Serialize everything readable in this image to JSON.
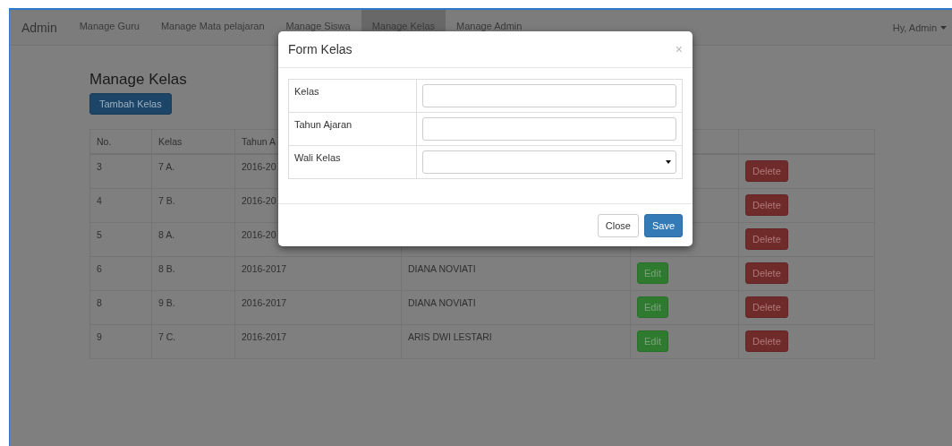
{
  "navbar": {
    "brand": "Admin",
    "items": [
      {
        "label": "Manage Guru",
        "selected": false
      },
      {
        "label": "Manage Mata pelajaran",
        "selected": false
      },
      {
        "label": "Manage Siswa",
        "selected": false
      },
      {
        "label": "Manage Kelas",
        "selected": true
      },
      {
        "label": "Manage Admin",
        "selected": false
      }
    ],
    "user_menu": "Hy, Admin"
  },
  "page": {
    "title": "Manage Kelas",
    "add_button": "Tambah Kelas"
  },
  "table": {
    "columns": [
      "No.",
      "Kelas",
      "Tahun A"
    ],
    "rows": [
      {
        "no": "3",
        "kelas": "7 A.",
        "tahun": "2016-20",
        "delete": "Delete"
      },
      {
        "no": "4",
        "kelas": "7 B.",
        "tahun": "2016-20",
        "delete": "Delete"
      },
      {
        "no": "5",
        "kelas": "8 A.",
        "tahun": "2016-20",
        "delete": "Delete"
      },
      {
        "no": "6",
        "kelas": "8 B.",
        "tahun": "2016-2017",
        "wali": "DIANA NOVIATI",
        "edit": "Edit",
        "delete": "Delete"
      },
      {
        "no": "8",
        "kelas": "9 B.",
        "tahun": "2016-2017",
        "wali": "DIANA NOVIATI",
        "edit": "Edit",
        "delete": "Delete"
      },
      {
        "no": "9",
        "kelas": "7 C.",
        "tahun": "2016-2017",
        "wali": "ARIS DWI LESTARI",
        "edit": "Edit",
        "delete": "Delete"
      }
    ]
  },
  "modal": {
    "title": "Form Kelas",
    "close_icon": "×",
    "fields": [
      {
        "label": "Kelas",
        "kind": "text"
      },
      {
        "label": "Tahun Ajaran",
        "kind": "text"
      },
      {
        "label": "Wali Kelas",
        "kind": "select"
      }
    ],
    "buttons": [
      {
        "label": "Close",
        "kind": "default"
      },
      {
        "label": "Save",
        "kind": "primary"
      }
    ]
  }
}
